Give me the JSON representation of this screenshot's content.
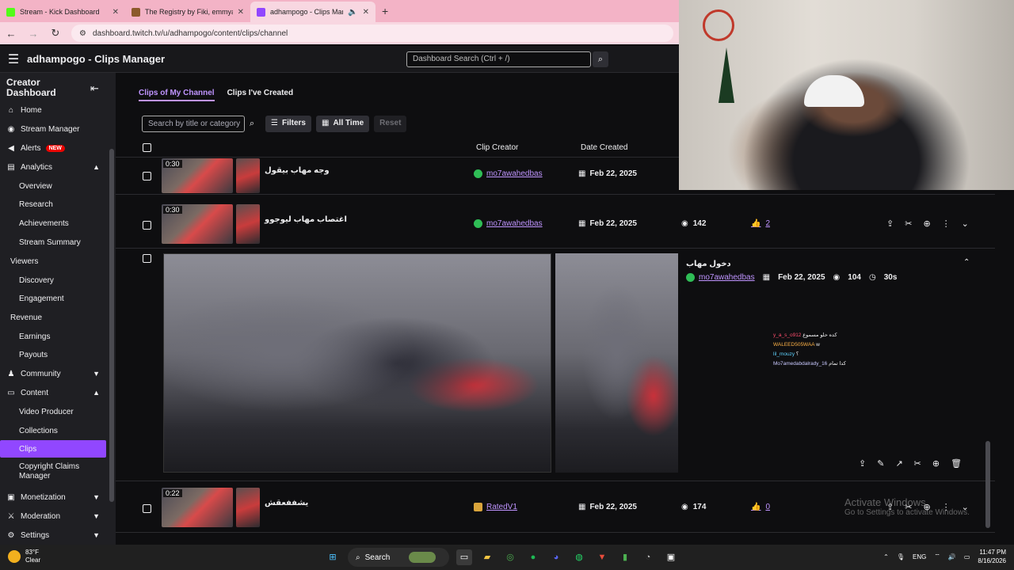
{
  "browser": {
    "tabs": [
      {
        "title": "Stream - Kick Dashboard",
        "color": "#53fc18"
      },
      {
        "title": "The Registry by Fiki, emmyalshe",
        "color": "#8b5a2b"
      },
      {
        "title": "adhampogo - Clips Manag",
        "color": "#9147ff"
      }
    ],
    "url": "dashboard.twitch.tv/u/adhampogo/content/clips/channel"
  },
  "topbar": {
    "title": "adhampogo - Clips Manager",
    "search_placeholder": "Dashboard Search (Ctrl + /)"
  },
  "sidebar": {
    "heading": "Creator Dashboard",
    "items": [
      {
        "label": "Home",
        "icon": "home-icon"
      },
      {
        "label": "Stream Manager",
        "icon": "stream-manager-icon"
      },
      {
        "label": "Alerts",
        "badge": "NEW",
        "icon": "alerts-icon"
      },
      {
        "label": "Analytics",
        "icon": "analytics-icon"
      },
      {
        "label": "Overview"
      },
      {
        "label": "Research"
      },
      {
        "label": "Achievements"
      },
      {
        "label": "Stream Summary"
      },
      {
        "label": "Viewers"
      },
      {
        "label": "Discovery"
      },
      {
        "label": "Engagement"
      },
      {
        "label": "Revenue"
      },
      {
        "label": "Earnings"
      },
      {
        "label": "Payouts"
      },
      {
        "label": "Community",
        "icon": "community-icon"
      },
      {
        "label": "Content",
        "icon": "content-icon"
      },
      {
        "label": "Video Producer"
      },
      {
        "label": "Collections"
      },
      {
        "label": "Clips"
      },
      {
        "label": "Copyright Claims Manager"
      },
      {
        "label": "Monetization",
        "icon": "monetization-icon"
      },
      {
        "label": "Moderation",
        "icon": "moderation-icon"
      },
      {
        "label": "Settings",
        "icon": "settings-icon"
      }
    ]
  },
  "main": {
    "tabs": [
      "Clips of My Channel",
      "Clips I've Created"
    ],
    "search_placeholder": "Search by title or category",
    "filters_label": "Filters",
    "alltime_label": "All Time",
    "reset_label": "Reset",
    "columns": {
      "creator": "Clip Creator",
      "date": "Date Created"
    },
    "rows": [
      {
        "duration": "0:30",
        "title": "وجه مهاب بيقول",
        "creator": "mo7awahedbas",
        "date": "Feb 22, 2025"
      },
      {
        "duration": "0:30",
        "title": "اغتصاب مهاب ليوجوو",
        "creator": "mo7awahedbas",
        "date": "Feb 22, 2025",
        "views": "142",
        "likes": "2"
      },
      {
        "duration": "0:22",
        "title": "يشففعقش",
        "creator": "RatedV1",
        "date": "Feb 22, 2025",
        "views": "174",
        "likes": "0"
      }
    ],
    "expanded": {
      "title": "دخول مهاب",
      "creator": "mo7awahedbas",
      "date": "Feb 22, 2025",
      "views": "104",
      "duration": "30s",
      "chat": [
        {
          "user": "y_a_s_o912",
          "msg": "كده حلو مسموع",
          "color": "#ff4d6d"
        },
        {
          "user": "WALEED505WAA",
          "msg": "w",
          "color": "#ffb347"
        },
        {
          "user": "lil_mouzy",
          "msg": "؟",
          "color": "#5fd3ff"
        },
        {
          "user": "Mo7amedabdalrady_16",
          "msg": "كدا تمام",
          "color": "#c9c9ff"
        }
      ]
    }
  },
  "watermark": {
    "line1": "Activate Windows",
    "line2": "Go to Settings to activate Windows."
  },
  "taskbar": {
    "weather_temp": "83°F",
    "weather_desc": "Clear",
    "search_label": "Search",
    "lang": "ENG",
    "time": "11:47 PM",
    "date": "8/16/2026"
  }
}
